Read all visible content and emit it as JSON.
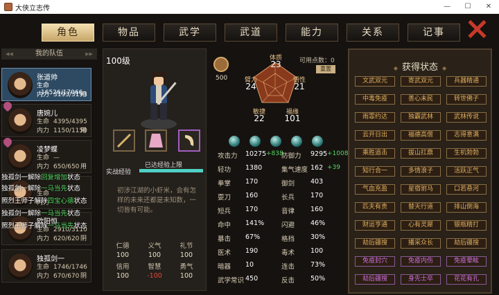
{
  "window": {
    "title": "大侠立志传",
    "minimize": "—",
    "maximize": "☐",
    "close": "✕"
  },
  "tabs": [
    "角色",
    "物品",
    "武学",
    "武道",
    "能力",
    "关系",
    "记事"
  ],
  "tab_notice_index": 3,
  "team_header": "我的队伍",
  "team": [
    {
      "name": "张道帅",
      "hp_label": "生命",
      "hp": "16526/17066",
      "mp_label": "内力",
      "mp": "3193/3193",
      "count": "用"
    },
    {
      "name": "唐婉儿",
      "hp_label": "生命",
      "hp": "4395/4395",
      "mp_label": "内力",
      "mp": "1150/1150",
      "count": "用"
    },
    {
      "name": "凌梦蝶",
      "hp_label": "生命",
      "hp": "—",
      "mp_label": "内力",
      "mp": "650/650",
      "count": "用"
    },
    {
      "name": "",
      "hp_label": "生命",
      "hp": "",
      "mp_label": "内力",
      "mp": "",
      "count": ""
    },
    {
      "name": "欧阳恒",
      "hp_label": "生命",
      "hp": "2910/3110",
      "mp_label": "内力",
      "mp": "620/620",
      "count": "阴"
    },
    {
      "name": "独孤剑一",
      "hp_label": "生命",
      "hp": "1746/1746",
      "mp_label": "内力",
      "mp": "670/670",
      "count": "阴"
    }
  ],
  "overlay_lines": [
    {
      "pre": "独孤剑一解除",
      "g": "回复增加",
      "post": "状态"
    },
    {
      "pre": "独孤剑一解除",
      "g": "一马当先",
      "post": "状态"
    },
    {
      "pre": "照烈王师子解除",
      "g": "四宝心德",
      "post": "状态"
    },
    {
      "pre": "独孤剑一解除",
      "g": "一马当先",
      "post": "状态"
    },
    {
      "pre": "照烈王师子解除",
      "g": "一马当先",
      "post": "状态"
    }
  ],
  "character": {
    "level": "100级",
    "xp_text": "已达经验上限",
    "xp_label": "实战经验",
    "xp_fraction": 1.0,
    "bio": "初涉江湖的小虾米，会有怎样的未来还都是未知数，一切皆有可能。",
    "virtues": [
      {
        "k": "仁德",
        "v": "100"
      },
      {
        "k": "义气",
        "v": "100"
      },
      {
        "k": "礼节",
        "v": "100"
      },
      {
        "k": "信用",
        "v": "100"
      },
      {
        "k": "智慧",
        "v": "-100"
      },
      {
        "k": "勇气",
        "v": "100"
      }
    ]
  },
  "stats": {
    "profession_value": "500",
    "points_label": "可用点数：0",
    "reset_label": "重置",
    "radar": [
      {
        "k": "体质",
        "v": "23"
      },
      {
        "k": "悟性",
        "v": "21"
      },
      {
        "k": "福缘",
        "v": "101"
      },
      {
        "k": "敏捷",
        "v": "22"
      },
      {
        "k": "臂力",
        "v": "24"
      }
    ],
    "rows": [
      {
        "ak": "攻击力",
        "av": "10275",
        "ab": "+838",
        "bk": "防御力",
        "bv": "9295",
        "bb": "+1008"
      },
      {
        "ak": "轻功",
        "av": "1380",
        "ab": "",
        "bk": "集气速度",
        "bv": "162",
        "bb": "+39"
      },
      {
        "ak": "拳掌",
        "av": "170",
        "ab": "",
        "bk": "御剑",
        "bv": "403",
        "bb": ""
      },
      {
        "ak": "耍刀",
        "av": "160",
        "ab": "",
        "bk": "长兵",
        "bv": "170",
        "bb": ""
      },
      {
        "ak": "短兵",
        "av": "170",
        "ab": "",
        "bk": "音律",
        "bv": "160",
        "bb": ""
      },
      {
        "ak": "命中",
        "av": "141%",
        "ab": "",
        "bk": "闪避",
        "bv": "46%",
        "bb": ""
      },
      {
        "ak": "暴击",
        "av": "67%",
        "ab": "",
        "bk": "格挡",
        "bv": "30%",
        "bb": ""
      },
      {
        "ak": "医术",
        "av": "190",
        "ab": "",
        "bk": "毒术",
        "bv": "100",
        "bb": ""
      },
      {
        "ak": "暗器",
        "av": "10",
        "ab": "",
        "bk": "连击",
        "bv": "73%",
        "bb": ""
      },
      {
        "ak": "武学常识",
        "av": "450",
        "ab": "",
        "bk": "反击",
        "bv": "50%",
        "bb": ""
      }
    ]
  },
  "status": {
    "title": "获得状态",
    "items": [
      {
        "t": "文武双元",
        "p": false
      },
      {
        "t": "寄武双元",
        "p": false
      },
      {
        "t": "兵器精通",
        "p": false
      },
      {
        "t": "中毒免疫",
        "p": false
      },
      {
        "t": "善心未民",
        "p": false
      },
      {
        "t": "转世佛子",
        "p": false
      },
      {
        "t": "雨霏约达",
        "p": false
      },
      {
        "t": "独霸武林",
        "p": false
      },
      {
        "t": "武林传说",
        "p": false
      },
      {
        "t": "云开日出",
        "p": false
      },
      {
        "t": "福德高僧",
        "p": false
      },
      {
        "t": "志得意满",
        "p": false
      },
      {
        "t": "乘胜追击",
        "p": false
      },
      {
        "t": "拔山扛鼎",
        "p": false
      },
      {
        "t": "生机勃勃",
        "p": false
      },
      {
        "t": "知行合一",
        "p": false
      },
      {
        "t": "多情浪子",
        "p": false
      },
      {
        "t": "活跃正气",
        "p": false
      },
      {
        "t": "气血充盈",
        "p": false
      },
      {
        "t": "星宿驸马",
        "p": false
      },
      {
        "t": "口若悬河",
        "p": false
      },
      {
        "t": "匹夫有责",
        "p": false
      },
      {
        "t": "替天行道",
        "p": false
      },
      {
        "t": "排山倒海",
        "p": false
      },
      {
        "t": "财运亨通",
        "p": false
      },
      {
        "t": "心有灵犀",
        "p": false
      },
      {
        "t": "银瓶精打",
        "p": false
      },
      {
        "t": "劫后疆搜",
        "p": false
      },
      {
        "t": "播采众长",
        "p": false
      },
      {
        "t": "劫后疆搜",
        "p": false
      },
      {
        "t": "免疫封穴",
        "p": true
      },
      {
        "t": "免疫内伤",
        "p": true
      },
      {
        "t": "免疫晕眩",
        "p": true
      },
      {
        "t": "劫后疆搜",
        "p": true
      },
      {
        "t": "身先士卒",
        "p": true
      },
      {
        "t": "花花有孔",
        "p": true
      }
    ]
  }
}
